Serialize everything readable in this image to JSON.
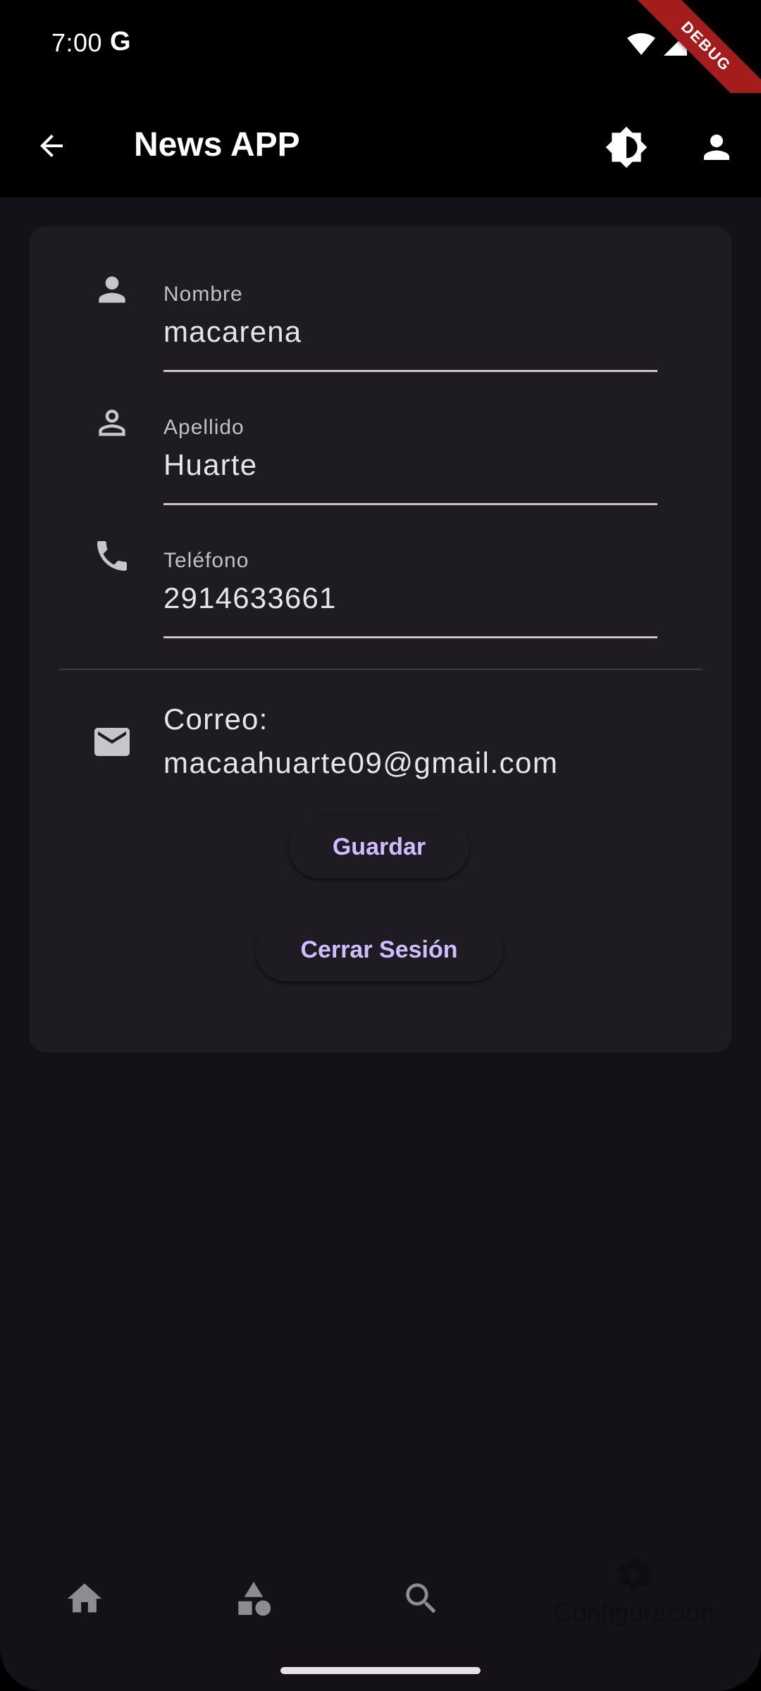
{
  "status_bar": {
    "time": "7:00",
    "g_label": "G"
  },
  "debug_banner": "DEBUG",
  "app_bar": {
    "title": "News APP"
  },
  "form": {
    "fields": [
      {
        "label": "Nombre",
        "value": "macarena",
        "icon": "person-icon"
      },
      {
        "label": "Apellido",
        "value": "Huarte",
        "icon": "person-outline-icon"
      },
      {
        "label": "Teléfono",
        "value": "2914633661",
        "icon": "phone-icon"
      }
    ],
    "email_label": "Correo:",
    "email_value": "macaahuarte09@gmail.com",
    "save_label": "Guardar",
    "logout_label": "Cerrar Sesión"
  },
  "bottom_nav": {
    "items": [
      {
        "icon": "home-icon",
        "label": ""
      },
      {
        "icon": "category-icon",
        "label": ""
      },
      {
        "icon": "search-icon",
        "label": ""
      },
      {
        "icon": "settings-icon",
        "label": "Configuración",
        "selected": true
      }
    ]
  },
  "colors": {
    "background": "#141218",
    "card": "#1e1c22",
    "accent": "#d0bcff",
    "debug": "#a51c1c"
  }
}
